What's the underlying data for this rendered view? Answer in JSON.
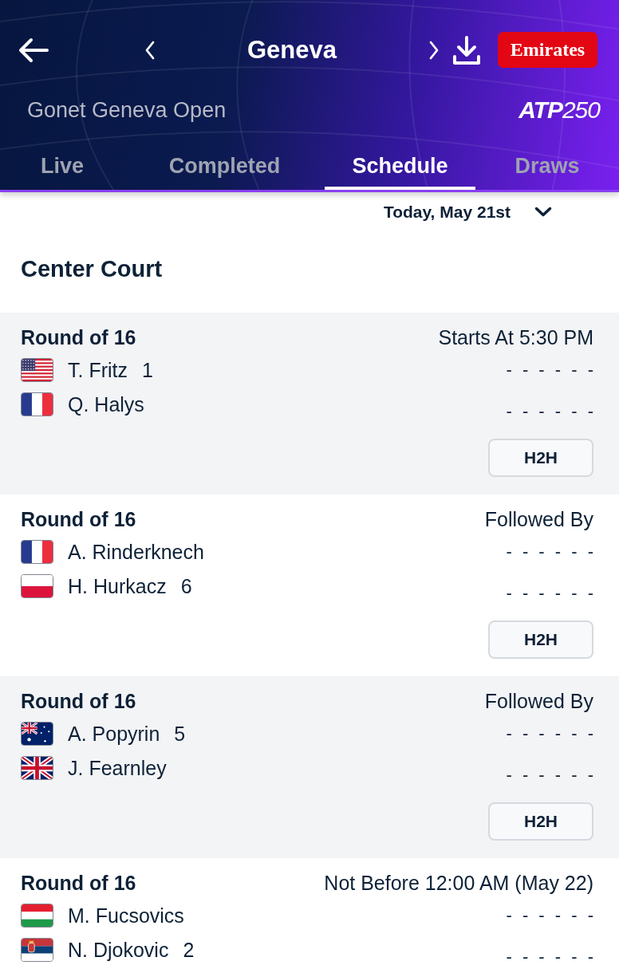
{
  "header": {
    "title": "Geneva",
    "sponsor": "Emirates",
    "tournament": "Gonet Geneva Open",
    "tour_logo": "**ATP**250"
  },
  "tabs": [
    {
      "label": "Live",
      "selected": false
    },
    {
      "label": "Completed",
      "selected": false
    },
    {
      "label": "Schedule",
      "selected": true
    },
    {
      "label": "Draws",
      "selected": false
    }
  ],
  "date_picker": {
    "value": "Today, May 21st"
  },
  "court": "Center Court",
  "matches": [
    {
      "round": "Round of 16",
      "time": "Starts At 5:30 PM",
      "players": [
        {
          "kind": "usa",
          "name": "T. Fritz",
          "seed": "1",
          "score": "- - - - - -"
        },
        {
          "kind": "france",
          "name": "Q. Halys",
          "score": "- - - - - -"
        }
      ],
      "button": "H2H"
    },
    {
      "round": "Round of 16",
      "time": "Followed By",
      "players": [
        {
          "kind": "france",
          "name": "A. Rinderknech",
          "score": "- - - - - -"
        },
        {
          "kind": "poland",
          "name": "H. Hurkacz",
          "seed": "6",
          "score": "- - - - - -"
        }
      ],
      "button": "H2H"
    },
    {
      "round": "Round of 16",
      "time": "Followed By",
      "players": [
        {
          "kind": "australia",
          "name": "A. Popyrin",
          "seed": "5",
          "score": "- - - - - -"
        },
        {
          "kind": "uk",
          "name": "J. Fearnley",
          "score": "- - - - - -"
        }
      ],
      "button": "H2H"
    },
    {
      "round": "Round of 16",
      "time": "Not Before 12:00 AM (May 22)",
      "players": [
        {
          "kind": "hungary",
          "name": "M. Fucsovics",
          "score": "- - - - - -"
        },
        {
          "kind": "serbia",
          "name": "N. Djokovic",
          "seed": "2",
          "score": "- - - - - -"
        }
      ]
    }
  ]
}
